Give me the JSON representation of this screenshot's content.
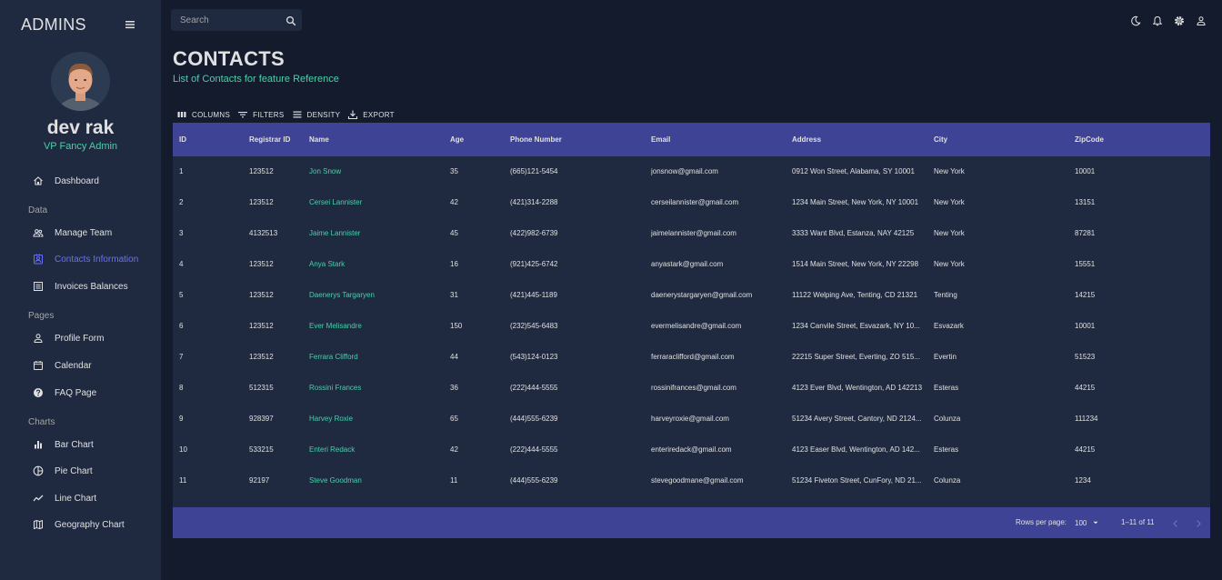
{
  "app": {
    "brand": "ADMINS"
  },
  "user": {
    "name": "dev rak",
    "role": "VP Fancy Admin"
  },
  "sidebar": {
    "items": [
      {
        "label": "Dashboard",
        "icon": "home-icon"
      },
      {
        "label": "Manage Team",
        "icon": "people-icon"
      },
      {
        "label": "Contacts Information",
        "icon": "contacts-icon",
        "active": true
      },
      {
        "label": "Invoices Balances",
        "icon": "receipt-icon"
      },
      {
        "label": "Profile Form",
        "icon": "person-icon"
      },
      {
        "label": "Calendar",
        "icon": "calendar-icon"
      },
      {
        "label": "FAQ Page",
        "icon": "help-icon"
      },
      {
        "label": "Bar Chart",
        "icon": "bar-chart-icon"
      },
      {
        "label": "Pie Chart",
        "icon": "pie-chart-icon"
      },
      {
        "label": "Line Chart",
        "icon": "line-chart-icon"
      },
      {
        "label": "Geography Chart",
        "icon": "map-icon"
      }
    ],
    "sections": {
      "data": "Data",
      "pages": "Pages",
      "charts": "Charts"
    }
  },
  "topbar": {
    "search_placeholder": "Search",
    "icons": [
      "dark-mode-icon",
      "notifications-icon",
      "settings-icon",
      "profile-icon"
    ]
  },
  "header": {
    "title": "CONTACTS",
    "subtitle": "List of Contacts for feature Reference"
  },
  "toolbar": {
    "columns": "COLUMNS",
    "filters": "FILTERS",
    "density": "DENSITY",
    "export": "EXPORT"
  },
  "table": {
    "columns": [
      "ID",
      "Registrar ID",
      "Name",
      "Age",
      "Phone Number",
      "Email",
      "Address",
      "City",
      "ZipCode"
    ],
    "rows": [
      [
        "1",
        "123512",
        "Jon Snow",
        "35",
        "(665)121-5454",
        "jonsnow@gmail.com",
        "0912 Won Street, Alabama, SY 10001",
        "New York",
        "10001"
      ],
      [
        "2",
        "123512",
        "Cersei Lannister",
        "42",
        "(421)314-2288",
        "cerseilannister@gmail.com",
        "1234 Main Street, New York, NY 10001",
        "New York",
        "13151"
      ],
      [
        "3",
        "4132513",
        "Jaime Lannister",
        "45",
        "(422)982-6739",
        "jaimelannister@gmail.com",
        "3333 Want Blvd, Estanza, NAY 42125",
        "New York",
        "87281"
      ],
      [
        "4",
        "123512",
        "Anya Stark",
        "16",
        "(921)425-6742",
        "anyastark@gmail.com",
        "1514 Main Street, New York, NY 22298",
        "New York",
        "15551"
      ],
      [
        "5",
        "123512",
        "Daenerys Targaryen",
        "31",
        "(421)445-1189",
        "daenerystargaryen@gmail.com",
        "11122 Welping Ave, Tenting, CD 21321",
        "Tenting",
        "14215"
      ],
      [
        "6",
        "123512",
        "Ever Melisandre",
        "150",
        "(232)545-6483",
        "evermelisandre@gmail.com",
        "1234 Canvile Street, Esvazark, NY 10...",
        "Esvazark",
        "10001"
      ],
      [
        "7",
        "123512",
        "Ferrara Clifford",
        "44",
        "(543)124-0123",
        "ferraraclifford@gmail.com",
        "22215 Super Street, Everting, ZO 515...",
        "Evertin",
        "51523"
      ],
      [
        "8",
        "512315",
        "Rossini Frances",
        "36",
        "(222)444-5555",
        "rossinifrances@gmail.com",
        "4123 Ever Blvd, Wentington, AD 142213",
        "Esteras",
        "44215"
      ],
      [
        "9",
        "928397",
        "Harvey Roxie",
        "65",
        "(444)555-6239",
        "harveyroxie@gmail.com",
        "51234 Avery Street, Cantory, ND 2124...",
        "Colunza",
        "111234"
      ],
      [
        "10",
        "533215",
        "Enteri Redack",
        "42",
        "(222)444-5555",
        "enteriredack@gmail.com",
        "4123 Easer Blvd, Wentington, AD 142...",
        "Esteras",
        "44215"
      ],
      [
        "11",
        "92197",
        "Steve Goodman",
        "11",
        "(444)555-6239",
        "stevegoodmane@gmail.com",
        "51234 Fiveton Street, CunFory, ND 21...",
        "Colunza",
        "1234"
      ]
    ]
  },
  "footer": {
    "rows_per_page_label": "Rows per page:",
    "rows_per_page_value": "100",
    "range": "1–11 of 11"
  },
  "colors": {
    "accent": "#4cceac",
    "header_bg": "#3e4396",
    "panel_bg": "#1f2a40",
    "page_bg": "#141b2d",
    "active": "#6870fa"
  }
}
